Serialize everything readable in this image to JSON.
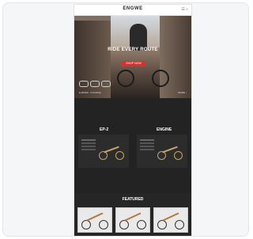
{
  "site": {
    "logo": "ENGWE",
    "top_icons": "☰ ⌕"
  },
  "hero": {
    "title": "RIDE EVERY ROUTE",
    "cta": "SHOP NOW",
    "meta_left": "E-BIKES · FOLDING",
    "meta_right": "MORE ›"
  },
  "collections": [
    {
      "title": "EP-2"
    },
    {
      "title": "ENGINE"
    }
  ],
  "featured": {
    "title": "FEATURED"
  },
  "colors": {
    "accent": "#d9302c",
    "dark": "#232323"
  }
}
